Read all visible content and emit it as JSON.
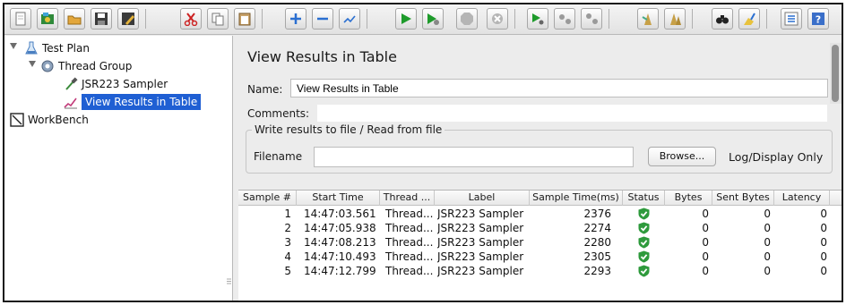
{
  "toolbar": {
    "buttons": [
      {
        "name": "new-template-icon"
      },
      {
        "name": "templates-icon"
      },
      {
        "name": "open-icon"
      },
      {
        "name": "save-icon"
      },
      {
        "name": "save-as-icon"
      },
      {
        "name": "cut-icon"
      },
      {
        "name": "copy-icon"
      },
      {
        "name": "paste-icon"
      },
      {
        "name": "expand-icon"
      },
      {
        "name": "collapse-icon"
      },
      {
        "name": "toggle-icon"
      },
      {
        "name": "start-icon"
      },
      {
        "name": "start-no-pause-icon"
      },
      {
        "name": "stop-icon"
      },
      {
        "name": "shutdown-icon"
      },
      {
        "name": "remote-start-icon"
      },
      {
        "name": "remote-stop-icon"
      },
      {
        "name": "remote-shutdown-icon"
      },
      {
        "name": "clear-icon"
      },
      {
        "name": "clear-all-icon"
      },
      {
        "name": "search-icon"
      },
      {
        "name": "reset-search-icon"
      },
      {
        "name": "function-helper-icon"
      },
      {
        "name": "help-icon"
      }
    ]
  },
  "tree": {
    "items": [
      {
        "label": "Test Plan"
      },
      {
        "label": "Thread Group"
      },
      {
        "label": "JSR223 Sampler"
      },
      {
        "label": "View Results in Table"
      },
      {
        "label": "WorkBench"
      }
    ]
  },
  "panel": {
    "title": "View Results in Table",
    "name_label": "Name:",
    "name_value": "View Results in Table",
    "comments_label": "Comments:",
    "comments_value": "",
    "group_legend": "Write results to file / Read from file",
    "filename_label": "Filename",
    "filename_value": "",
    "browse_label": "Browse...",
    "log_display_label": "Log/Display Only"
  },
  "table": {
    "columns": [
      "Sample #",
      "Start Time",
      "Thread ...",
      "Label",
      "Sample Time(ms)",
      "Status",
      "Bytes",
      "Sent Bytes",
      "Latency"
    ],
    "rows": [
      {
        "n": "1",
        "start": "14:47:03.561",
        "thread": "Thread...",
        "label": "JSR223 Sampler",
        "time": "2376",
        "status": "success",
        "bytes": "0",
        "sent": "0",
        "latency": "0"
      },
      {
        "n": "2",
        "start": "14:47:05.938",
        "thread": "Thread...",
        "label": "JSR223 Sampler",
        "time": "2274",
        "status": "success",
        "bytes": "0",
        "sent": "0",
        "latency": "0"
      },
      {
        "n": "3",
        "start": "14:47:08.213",
        "thread": "Thread...",
        "label": "JSR223 Sampler",
        "time": "2280",
        "status": "success",
        "bytes": "0",
        "sent": "0",
        "latency": "0"
      },
      {
        "n": "4",
        "start": "14:47:10.493",
        "thread": "Thread...",
        "label": "JSR223 Sampler",
        "time": "2305",
        "status": "success",
        "bytes": "0",
        "sent": "0",
        "latency": "0"
      },
      {
        "n": "5",
        "start": "14:47:12.799",
        "thread": "Thread...",
        "label": "JSR223 Sampler",
        "time": "2293",
        "status": "success",
        "bytes": "0",
        "sent": "0",
        "latency": "0"
      }
    ]
  },
  "colors": {
    "selection": "#1f5fd3",
    "status_ok": "#2e9a3c",
    "play": "#1e9b2b"
  }
}
